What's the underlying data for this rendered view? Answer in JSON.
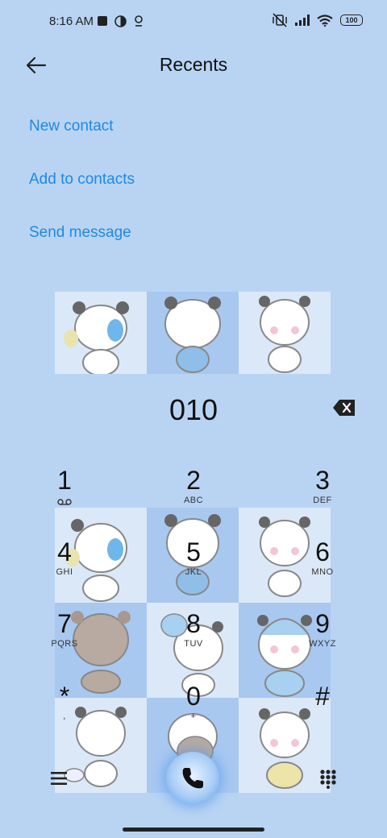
{
  "status_bar": {
    "time": "8:16 AM",
    "battery": "100"
  },
  "header": {
    "title": "Recents"
  },
  "actions": [
    {
      "label": "New contact"
    },
    {
      "label": "Add to contacts"
    },
    {
      "label": "Send message"
    }
  ],
  "dialer": {
    "number": "010"
  },
  "keypad": [
    {
      "digit": "1",
      "letters": ""
    },
    {
      "digit": "2",
      "letters": "ABC"
    },
    {
      "digit": "3",
      "letters": "DEF"
    },
    {
      "digit": "4",
      "letters": "GHI"
    },
    {
      "digit": "5",
      "letters": "JKL"
    },
    {
      "digit": "6",
      "letters": "MNO"
    },
    {
      "digit": "7",
      "letters": "PQRS"
    },
    {
      "digit": "8",
      "letters": "TUV"
    },
    {
      "digit": "9",
      "letters": "WXYZ"
    },
    {
      "digit": "*",
      "letters": ","
    },
    {
      "digit": "0",
      "letters": "+"
    },
    {
      "digit": "#",
      "letters": ""
    }
  ],
  "colors": {
    "accent": "#1e88e5",
    "background": "#b9d4f3",
    "tile_light": "#dbe8f7",
    "tile_dark": "#a8c8f0"
  },
  "icons": {
    "back": "arrow-left-icon",
    "backspace": "backspace-icon",
    "voicemail": "voicemail-icon",
    "menu": "hamburger-menu-icon",
    "call": "phone-icon",
    "dialpad": "dialpad-icon"
  }
}
